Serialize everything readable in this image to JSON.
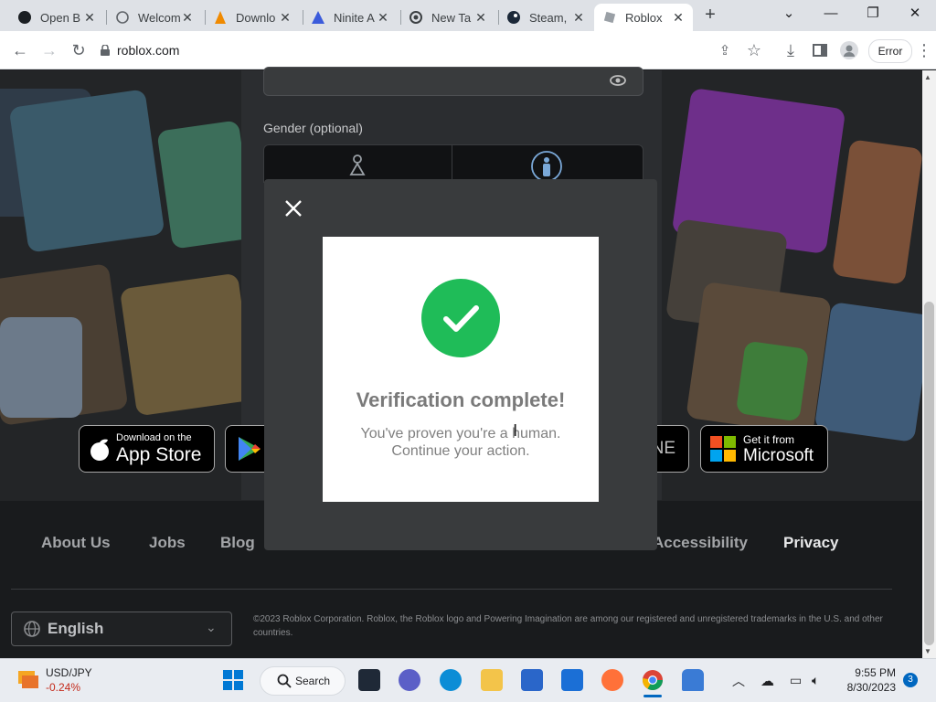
{
  "browser": {
    "tabs": [
      {
        "title": "Open B",
        "icon": "github-icon"
      },
      {
        "title": "Welcom",
        "icon": "globe-icon"
      },
      {
        "title": "Downlo",
        "icon": "vlc-icon"
      },
      {
        "title": "Ninite A",
        "icon": "ninite-icon"
      },
      {
        "title": "New Ta",
        "icon": "chrome-icon"
      },
      {
        "title": "Steam, ",
        "icon": "steam-icon"
      },
      {
        "title": "Roblox",
        "icon": "roblox-icon",
        "active": true
      }
    ],
    "new_tab": "+",
    "url": "roblox.com",
    "profile_status": "Error"
  },
  "signup": {
    "gender_label": "Gender (optional)"
  },
  "badges": {
    "app_store_small": "Download on the",
    "app_store_big": "App Store",
    "xbox_partial": "NE",
    "microsoft_small": "Get it from",
    "microsoft_big": "Microsoft"
  },
  "footer": {
    "links": [
      "About Us",
      "Jobs",
      "Blog",
      "Accessibility",
      "Privacy"
    ],
    "language": "English",
    "copyright": "©2023 Roblox Corporation. Roblox, the Roblox logo and Powering Imagination are among our registered and unregistered trademarks in the U.S. and other countries."
  },
  "modal": {
    "title": "Verification complete!",
    "line1": "You've proven you're a human.",
    "line2": "Continue your action."
  },
  "taskbar": {
    "ticker": "USD/JPY",
    "ticker_change": "-0.24%",
    "search_label": "Search",
    "time": "9:55 PM",
    "date": "8/30/2023",
    "notification_count": "3"
  },
  "colors": {
    "success": "#1fbc58",
    "modal_bg": "#393b3d",
    "ticker_negative": "#c42b1c"
  }
}
